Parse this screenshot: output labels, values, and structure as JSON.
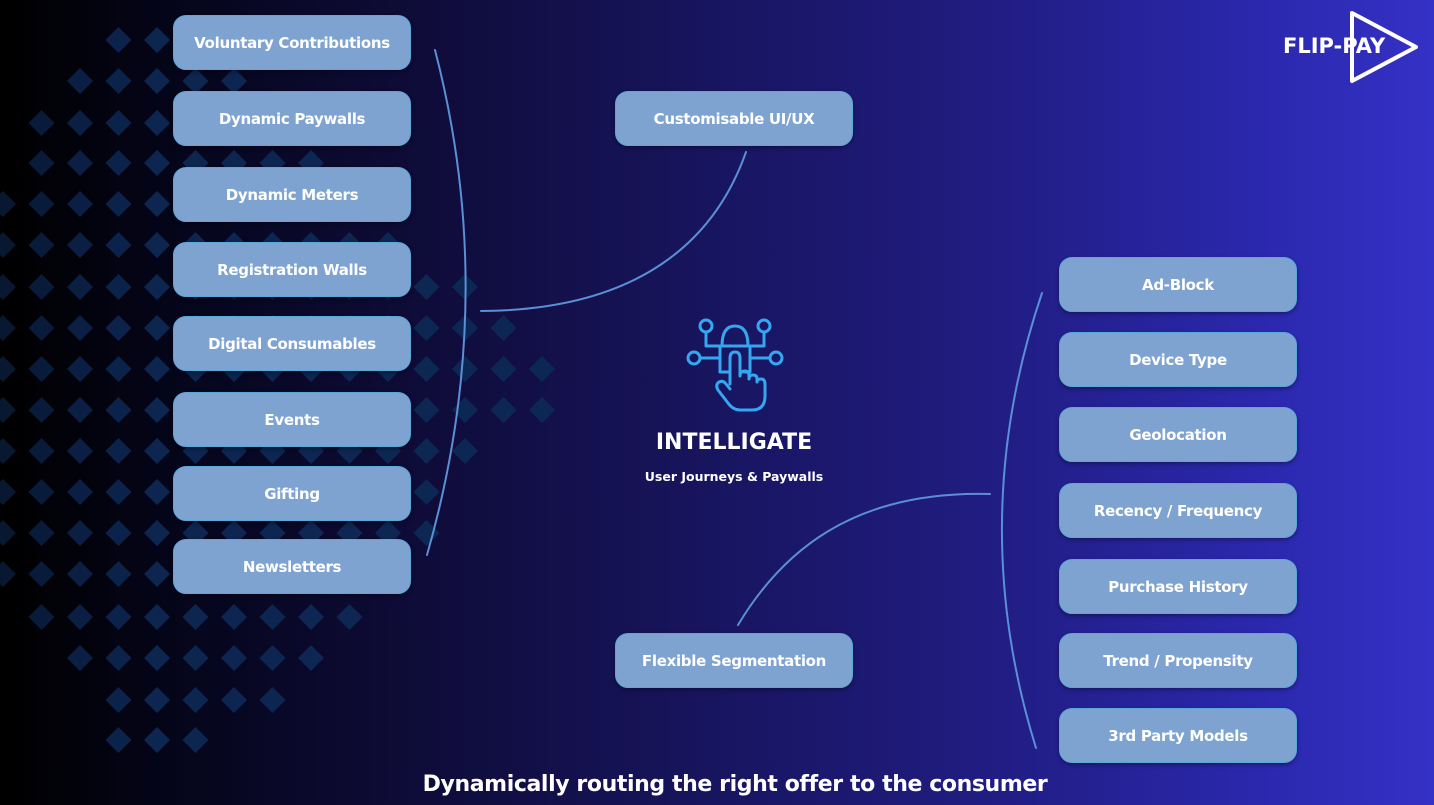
{
  "brand": {
    "logo_text": "FLIP-PAY",
    "logo_icon": "play-triangle-icon",
    "colors": {
      "background_start": "#000000",
      "background_end": "#3431c6",
      "node_fill": "#7ea3d1",
      "node_border": "#5aa8d8",
      "connector": "#5b8fd6",
      "icon_accent": "#35a7f0",
      "pattern_diamond": "#0d2a56"
    }
  },
  "center": {
    "icon": "lock-network-touch-icon",
    "title": "INTELLIGATE",
    "subtitle": "User Journeys & Paywalls"
  },
  "top_node": {
    "label": "Customisable UI/UX"
  },
  "bottom_node": {
    "label": "Flexible Segmentation"
  },
  "left_nodes": [
    {
      "label": "Voluntary Contributions"
    },
    {
      "label": "Dynamic Paywalls"
    },
    {
      "label": "Dynamic Meters"
    },
    {
      "label": "Registration Walls"
    },
    {
      "label": "Digital Consumables"
    },
    {
      "label": "Events"
    },
    {
      "label": "Gifting"
    },
    {
      "label": "Newsletters"
    }
  ],
  "right_nodes": [
    {
      "label": "Ad-Block"
    },
    {
      "label": "Device Type"
    },
    {
      "label": "Geolocation"
    },
    {
      "label": "Recency / Frequency"
    },
    {
      "label": "Purchase History"
    },
    {
      "label": "Trend / Propensity"
    },
    {
      "label": "3rd Party Models"
    }
  ],
  "tagline": "Dynamically routing the right offer to the consumer"
}
